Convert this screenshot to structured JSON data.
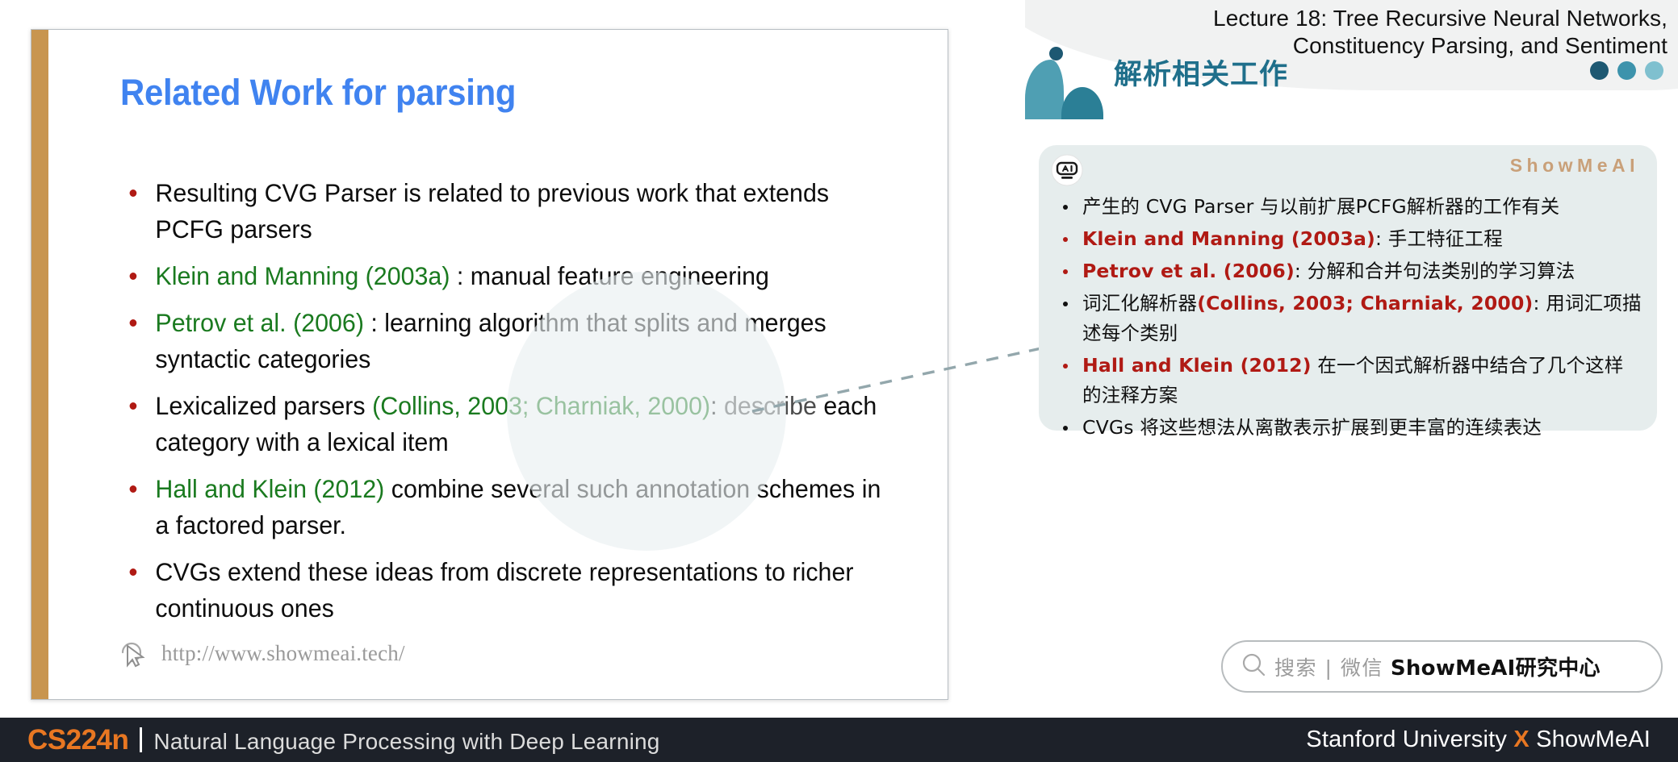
{
  "slide": {
    "title": "Related Work for parsing",
    "bullets": [
      {
        "segments": [
          {
            "text": "Resulting CVG Parser is related to previous work that extends PCFG parsers",
            "style": "plain"
          }
        ]
      },
      {
        "segments": [
          {
            "text": "Klein and Manning (2003a)",
            "style": "cite"
          },
          {
            "text": " : manual feature engineering",
            "style": "plain"
          }
        ]
      },
      {
        "segments": [
          {
            "text": "Petrov et al. (2006)",
            "style": "cite"
          },
          {
            "text": " : learning algorithm that splits and merges syntactic categories",
            "style": "plain"
          }
        ]
      },
      {
        "segments": [
          {
            "text": "Lexicalized parsers ",
            "style": "plain"
          },
          {
            "text": "(Collins, 2003; Charniak, 2000)",
            "style": "cite"
          },
          {
            "text": ": ",
            "style": "plain"
          },
          {
            "text": "describe",
            "style": "faded"
          },
          {
            "text": " each category with a lexical item",
            "style": "plain"
          }
        ]
      },
      {
        "segments": [
          {
            "text": "Hall and Klein (2012)",
            "style": "cite"
          },
          {
            "text": " combine several such annotation schemes in a factored parser.",
            "style": "plain"
          }
        ]
      },
      {
        "segments": [
          {
            "text": "CVGs extend these ideas from discrete representations to richer continuous ones",
            "style": "plain"
          }
        ]
      }
    ],
    "footer_url": "http://www.showmeai.tech/",
    "cursor_icon": "cursor-arrow-icon"
  },
  "header": {
    "lecture_title_line1": "Lecture 18: Tree Recursive Neural Networks,",
    "lecture_title_line2": "Constituency Parsing, and Sentiment",
    "chinese_title": "解析相关工作",
    "dot_colors": [
      "#1d5872",
      "#3d93ac",
      "#7fc0cf"
    ]
  },
  "panel": {
    "logo": "ShowMeAI",
    "robot_icon": "robot-ai-icon",
    "bullets": [
      {
        "segments": [
          {
            "text": "产生的 CVG Parser 与以前扩展PCFG解析器的工作有关",
            "style": "plain"
          }
        ],
        "lead": "plain"
      },
      {
        "segments": [
          {
            "text": "Klein and Manning (2003a)",
            "style": "cite"
          },
          {
            "text": ": 手工特征工程",
            "style": "plain"
          }
        ],
        "lead": "red"
      },
      {
        "segments": [
          {
            "text": "Petrov et al. (2006)",
            "style": "cite"
          },
          {
            "text": ": 分解和合并句法类别的学习算法",
            "style": "plain"
          }
        ],
        "lead": "red"
      },
      {
        "segments": [
          {
            "text": "词汇化解析器",
            "style": "plain"
          },
          {
            "text": "(Collins, 2003; Charniak, 2000)",
            "style": "cite"
          },
          {
            "text": ": 用词汇项描述每个类别",
            "style": "plain"
          }
        ],
        "lead": "plain"
      },
      {
        "segments": [
          {
            "text": "Hall and Klein (2012)",
            "style": "cite"
          },
          {
            "text": " 在一个因式解析器中结合了几个这样的注释方案",
            "style": "plain"
          }
        ],
        "lead": "red"
      },
      {
        "segments": [
          {
            "text": "CVGs 将这些想法从离散表示扩展到更丰富的连续表达",
            "style": "plain"
          }
        ],
        "lead": "plain"
      }
    ]
  },
  "search": {
    "icon": "magnifier-icon",
    "placeholder": "搜索 | 微信",
    "brand": "ShowMeAI研究中心"
  },
  "bottom_bar": {
    "course_code": "CS224n",
    "course_name": "Natural Language Processing with Deep Learning",
    "credit_left": "Stanford University",
    "credit_x": "X",
    "credit_right": "ShowMeAI"
  },
  "colors": {
    "title_blue": "#4083f0",
    "citation_green": "#1a7a1f",
    "citation_red": "#b01a14",
    "bullet_red": "#b01a14",
    "accent_gold": "#c8954f",
    "accent_orange": "#e87722",
    "panel_bg": "#e6eded",
    "teal": "#2b7f96",
    "bar_dark": "#1d2129"
  }
}
